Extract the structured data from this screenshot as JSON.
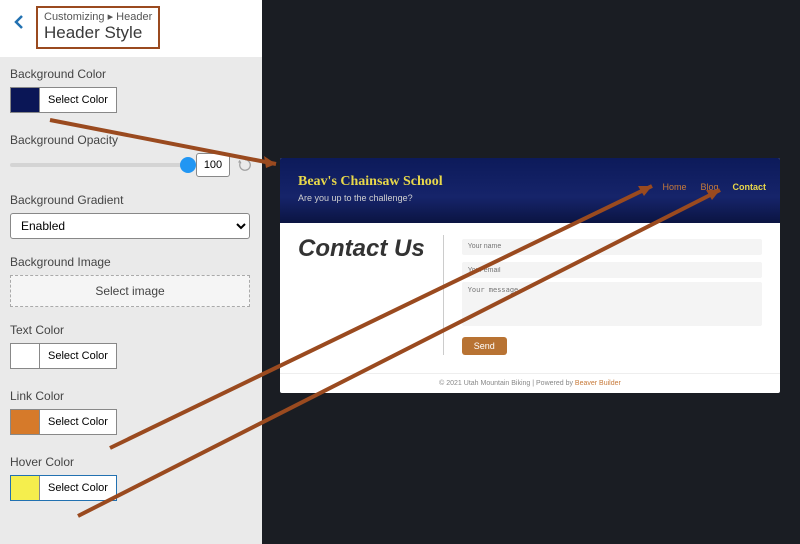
{
  "header": {
    "breadcrumb": "Customizing ▸ Header",
    "title": "Header Style"
  },
  "sections": {
    "bg_color": {
      "label": "Background Color",
      "swatch": "#0a1656",
      "btn": "Select Color"
    },
    "bg_opacity": {
      "label": "Background Opacity",
      "value": "100"
    },
    "bg_gradient": {
      "label": "Background Gradient",
      "selected": "Enabled"
    },
    "bg_image": {
      "label": "Background Image",
      "btn": "Select image"
    },
    "text_color": {
      "label": "Text Color",
      "swatch": "#ffffff",
      "btn": "Select Color"
    },
    "link_color": {
      "label": "Link Color",
      "swatch": "#d67a2a",
      "btn": "Select Color"
    },
    "hover_color": {
      "label": "Hover Color",
      "swatch": "#f5ee4d",
      "btn": "Select Color"
    }
  },
  "preview": {
    "title": "Beav's Chainsaw School",
    "tagline": "Are you up to the challenge?",
    "nav": {
      "home": "Home",
      "blog": "Blog",
      "contact": "Contact"
    },
    "page_heading": "Contact Us",
    "form": {
      "name_ph": "Your name",
      "email_ph": "Your email",
      "msg_ph": "Your message",
      "send": "Send"
    },
    "footer_a": "© 2021 Utah Mountain Biking | Powered by ",
    "footer_b": "Beaver Builder"
  }
}
